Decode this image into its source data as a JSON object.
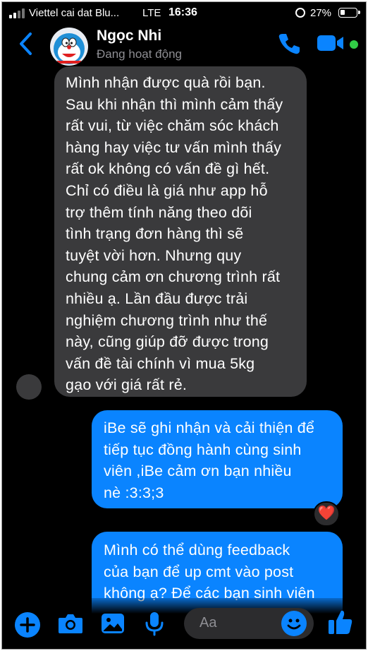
{
  "status_bar": {
    "carrier": "Viettel cai dat Blu...",
    "network": "LTE",
    "time": "16:36",
    "battery_percent": "27%",
    "battery_level": 0.27
  },
  "header": {
    "contact_name": "Ngọc Nhi",
    "contact_status": "Đang hoạt động",
    "accent_color": "#0a84ff",
    "online_color": "#31cc46"
  },
  "messages": [
    {
      "direction": "incoming",
      "lines": [
        "Mình nhận được quà rồi bạn.",
        "Sau khi nhận thì mình cảm thấy",
        "rất vui, từ việc chăm sóc khách",
        "hàng hay việc tư vấn mình thấy",
        "rất ok không có vấn đề gì hết.",
        "Chỉ có điều là giá như app hỗ",
        "trợ thêm tính năng theo dõi",
        "tình trạng đơn hàng thì sẽ",
        "tuyệt vời hơn. Nhưng quy",
        "chung cảm ơn chương trình rất",
        "nhiều ạ. Lần đầu được trải",
        "nghiệm chương trình như thế",
        "này, cũng giúp đỡ được trong",
        "vấn đề tài chính vì mua 5kg",
        "gạo với giá rất rẻ."
      ]
    },
    {
      "direction": "outgoing",
      "lines": [
        "iBe sẽ ghi nhận và cải thiện để",
        "tiếp tục đồng hành cùng sinh",
        "viên ,iBe cảm ơn bạn nhiều",
        "nè :3:3;3"
      ],
      "reaction": "❤️"
    },
    {
      "direction": "outgoing",
      "lines": [
        "Mình có thể dùng feedback",
        "của bạn để up cmt vào post",
        "không ạ? Để các bạn sinh viên"
      ]
    }
  ],
  "composer": {
    "placeholder": "Aa",
    "icons": [
      "plus-icon",
      "camera-icon",
      "image-icon",
      "microphone-icon",
      "emoji-icon",
      "thumbs-up-icon"
    ]
  }
}
